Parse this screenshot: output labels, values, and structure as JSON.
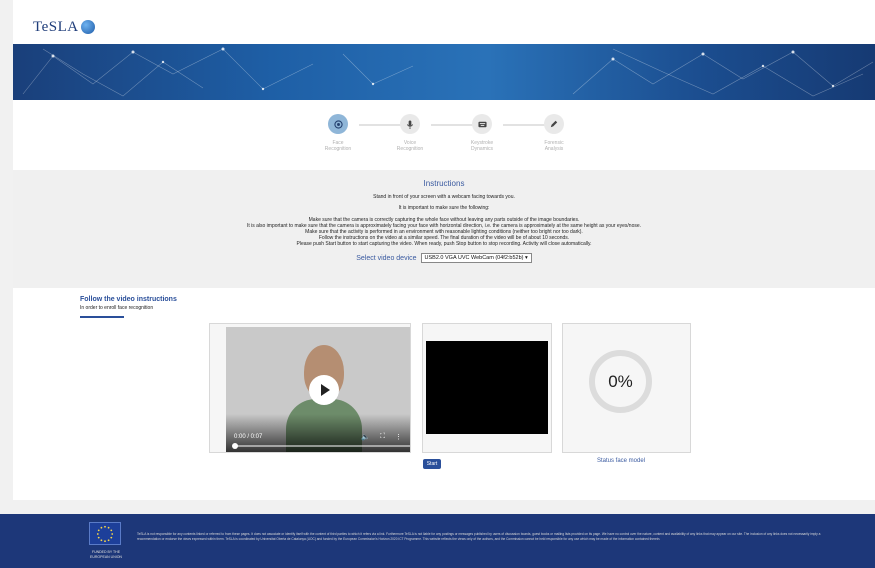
{
  "header": {
    "logo_text": "TeSLA"
  },
  "steps": [
    {
      "label": "Face\nRecognition",
      "icon": "camera-icon",
      "active": true
    },
    {
      "label": "Voice\nRecognition",
      "icon": "microphone-icon",
      "active": false
    },
    {
      "label": "Keystroke\nDynamics",
      "icon": "keyboard-icon",
      "active": false
    },
    {
      "label": "Forensic\nAnalysis",
      "icon": "pencil-icon",
      "active": false
    }
  ],
  "instructions": {
    "title": "Instructions",
    "line1": "Stand in front of your screen with a webcam facing towards you.",
    "line2": "It is important to make sure the following:",
    "line3": "Make sure that the camera is correctly capturing the whole face without leaving any parts outside of the image boundaries.",
    "line4": "It is also important to make sure that the camera is approximately facing your face with horizontal direction, i.e. the camera is approximately at the same height as your eyes/nose.",
    "line5": "Make sure that the activity is performed in an environment with reasonable lighting conditions (neither too bright nor too dark).",
    "line6": "Follow the instructions on the video at a similar speed. The final duration of the video will be of about 10 seconds.",
    "line7": "Please push Start button to start capturing the video. When ready, push Stop button to stop recording. Activity will close automatically.",
    "device_label": "Select video device",
    "device_value": "USB2.0 VGA UVC WebCam (04f2:b52b)"
  },
  "follow": {
    "title": "Follow the video instructions",
    "subtitle": "In order to enroll face recognition"
  },
  "video": {
    "time": "0:00 / 0:07",
    "progress": 0
  },
  "capture": {
    "start_label": "Start"
  },
  "status": {
    "percent": "0%",
    "link_label": "Status face model"
  },
  "footer": {
    "eu_label": "FUNDED BY THE EUROPEAN UNION",
    "text": "TeSLA is not responsible for any contents linked or referred to from these pages. It does not associate or identify itself with the content of third parties to which it refers via a link. Furthermore TeSLA is not liable for any postings or messages published by users of discussion boards, guest books or mailing lists provided on its page. We have no control over the nature, content and availability of any links that may appear on our site. The inclusion of any links does not necessarily imply a recommendation or endorse the views expressed within them. TeSLA is coordinated by Universitat Oberta de Catalunya (UOC) and funded by the European Commission's Horizon 2020 ICT Programme. This website reflects the views only of the authors, and the Commission cannot be held responsible for any use which may be made of the information contained therein."
  },
  "colors": {
    "accent": "#2a4f9a",
    "active_step": "#8fb6d8",
    "footer": "#1d3779"
  }
}
